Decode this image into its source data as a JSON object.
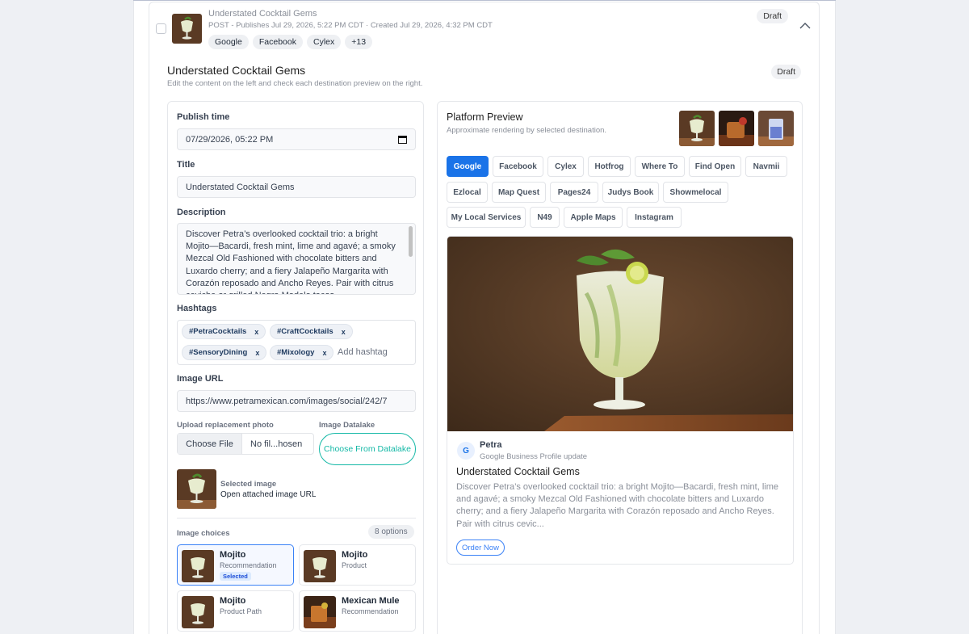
{
  "post": {
    "title": "Understated Cocktail Gems",
    "meta": "POST - Publishes Jul 29, 2026, 5:22 PM CDT · Created Jul 29, 2026, 4:32 PM CDT",
    "tags": [
      "Google",
      "Facebook",
      "Cylex",
      "+13"
    ],
    "status": "Draft"
  },
  "editor": {
    "title": "Understated Cocktail Gems",
    "subtitle": "Edit the content on the left and check each destination preview on the right.",
    "status": "Draft"
  },
  "form": {
    "publish_time_label": "Publish time",
    "publish_time_value": "07/29/2026, 05:22 PM",
    "title_label": "Title",
    "title_value": "Understated Cocktail Gems",
    "description_label": "Description",
    "description_value": "Discover Petra’s overlooked cocktail trio: a bright Mojito—Bacardi, fresh mint, lime and agavé; a smoky Mezcal Old Fashioned with chocolate bitters and Luxardo cherry; and a fiery Jalapeño Margarita with Corazón reposado and Ancho Reyes. Pair with citrus ceviche or grilled Negra Modelo tacos.",
    "hashtags_label": "Hashtags",
    "hashtags": [
      "#PetraCocktails",
      "#CraftCocktails",
      "#SensoryDining",
      "#Mixology"
    ],
    "hashtag_remove": "x",
    "hashtag_placeholder": "Add hashtag",
    "image_url_label": "Image URL",
    "image_url_value": "https://www.petramexican.com/images/social/242/7",
    "upload_label": "Upload replacement photo",
    "choose_file": "Choose File",
    "file_name": "No fil...hosen",
    "datalake_label": "Image Datalake",
    "datalake_button": "Choose From Datalake",
    "selected_image_label": "Selected image",
    "selected_image_link": "Open attached image URL",
    "image_choices_label": "Image choices",
    "image_choices_count": "8 options",
    "choices": [
      {
        "name": "Mojito",
        "type": "Recommendation",
        "badge": "Selected"
      },
      {
        "name": "Mojito",
        "type": "Product",
        "badge": ""
      },
      {
        "name": "Mojito",
        "type": "Product Path",
        "badge": ""
      },
      {
        "name": "Mexican Mule",
        "type": "Recommendation",
        "badge": ""
      }
    ]
  },
  "preview": {
    "title": "Platform Preview",
    "subtitle": "Approximate rendering by selected destination.",
    "tabs": [
      "Google",
      "Facebook",
      "Cylex",
      "Hotfrog",
      "Where To",
      "Find Open",
      "Navmii",
      "Ezlocal",
      "Map Quest",
      "Pages24",
      "Judys Book",
      "Showmelocal",
      "My Local Services",
      "N49",
      "Apple Maps",
      "Instagram"
    ],
    "active_tab": "Google",
    "avatar_letter": "G",
    "business_name": "Petra",
    "business_sub": "Google Business Profile update",
    "post_title": "Understated Cocktail Gems",
    "post_desc": "Discover Petra’s overlooked cocktail trio: a bright Mojito—Bacardi, fresh mint, lime and agavé; a smoky Mezcal Old Fashioned with chocolate bitters and Luxardo cherry; and a fiery Jalapeño Margarita with Corazón reposado and Ancho Reyes. Pair with citrus cevic...",
    "cta": "Order Now"
  },
  "colors": {
    "accent_blue": "#1a73e8",
    "teal": "#14b8a6",
    "selected_border": "#3b82f6"
  },
  "icons": [
    "calendar-icon",
    "chevron-up-icon",
    "google-g-icon"
  ]
}
